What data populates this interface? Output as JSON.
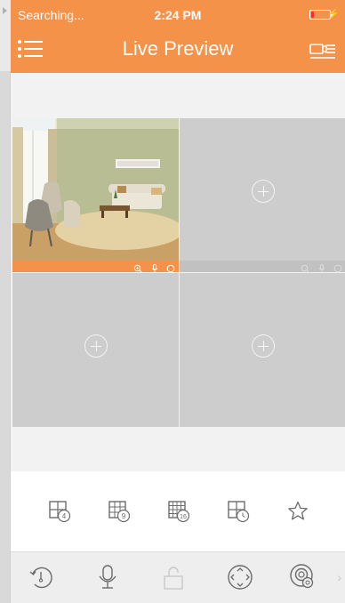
{
  "status_bar": {
    "carrier": "Searching...",
    "time": "2:24 PM",
    "battery_level": 0.15,
    "battery_color": "#ff2a2a"
  },
  "header": {
    "title": "Live Preview",
    "background": "#f5924a",
    "left_icon": "menu-icon",
    "right_icon": "device-list-icon"
  },
  "preview_grid": {
    "channels": [
      {
        "channel": 1,
        "state": "live",
        "toolbar_icons": [
          "zoom-icon",
          "microphone-icon",
          "record-icon"
        ]
      },
      {
        "channel": 2,
        "state": "empty",
        "icon": "add-device-icon"
      },
      {
        "channel": 3,
        "state": "empty",
        "icon": "add-device-icon"
      },
      {
        "channel": 4,
        "state": "empty",
        "icon": "add-device-icon"
      }
    ]
  },
  "layout_selector": {
    "options": [
      "layout-4-icon",
      "layout-9-icon",
      "layout-16-icon",
      "layout-sequence-icon",
      "favorite-star-icon"
    ]
  },
  "bottom_toolbar": {
    "items": [
      "playback-icon",
      "talk-microphone-icon",
      "unlock-icon",
      "ptz-control-icon",
      "snapshot-camera-icon",
      "chevron-right-icon"
    ]
  }
}
